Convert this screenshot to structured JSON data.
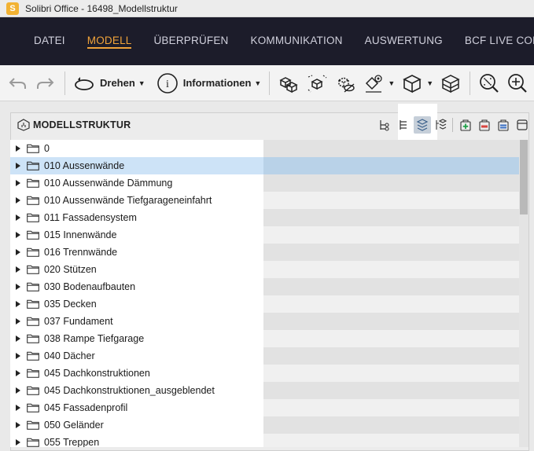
{
  "window": {
    "title": "Solibri Office - 16498_Modellstruktur",
    "app_icon_letter": "S"
  },
  "menu": {
    "items": [
      {
        "label": "DATEI",
        "active": false
      },
      {
        "label": "MODELL",
        "active": true
      },
      {
        "label": "ÜBERPRÜFEN",
        "active": false
      },
      {
        "label": "KOMMUNIKATION",
        "active": false
      },
      {
        "label": "AUSWERTUNG",
        "active": false
      },
      {
        "label": "BCF LIVE CON",
        "active": false
      }
    ]
  },
  "toolbar": {
    "rotate_label": "Drehen",
    "info_label": "Informationen",
    "info_icon_text": "i"
  },
  "panel": {
    "title": "MODELLSTRUKTUR"
  },
  "tree": {
    "rows": [
      {
        "label": "0",
        "selected": false
      },
      {
        "label": "010 Aussenwände",
        "selected": true
      },
      {
        "label": "010 Aussenwände Dämmung",
        "selected": false
      },
      {
        "label": "010 Aussenwände Tiefgarageneinfahrt",
        "selected": false
      },
      {
        "label": "011 Fassadensystem",
        "selected": false
      },
      {
        "label": "015 Innenwände",
        "selected": false
      },
      {
        "label": "016 Trennwände",
        "selected": false
      },
      {
        "label": "020 Stützen",
        "selected": false
      },
      {
        "label": "030 Bodenaufbauten",
        "selected": false
      },
      {
        "label": "035 Decken",
        "selected": false
      },
      {
        "label": "037 Fundament",
        "selected": false
      },
      {
        "label": "038 Rampe Tiefgarage",
        "selected": false
      },
      {
        "label": "040 Dächer",
        "selected": false
      },
      {
        "label": "045 Dachkonstruktionen",
        "selected": false
      },
      {
        "label": "045 Dachkonstruktionen_ausgeblendet",
        "selected": false
      },
      {
        "label": "045 Fassadenprofil",
        "selected": false
      },
      {
        "label": "050 Geländer",
        "selected": false
      },
      {
        "label": "055 Treppen",
        "selected": false
      }
    ]
  },
  "colors": {
    "menu_bg": "#1c1c2a",
    "menu_active": "#f0a33a",
    "selection": "#cde3f7"
  }
}
